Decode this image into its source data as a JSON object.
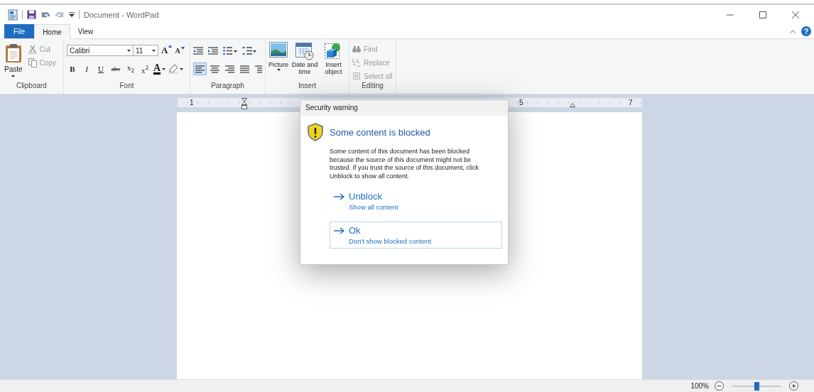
{
  "window": {
    "title": "Document - WordPad",
    "help": "?"
  },
  "tabs": [
    {
      "label": "File",
      "kind": "file",
      "selected": false
    },
    {
      "label": "Home",
      "kind": "tab",
      "selected": true
    },
    {
      "label": "View",
      "kind": "tab",
      "selected": false
    }
  ],
  "ribbon": {
    "clipboard": {
      "label": "Clipboard",
      "paste": "Paste",
      "cut": {
        "label": "Cut",
        "disabled": true
      },
      "copy": {
        "label": "Copy",
        "disabled": true
      }
    },
    "font": {
      "label": "Font",
      "font_name": "Calibri",
      "font_size": "11",
      "grow": "A",
      "shrink": "A",
      "format_buttons": [
        {
          "label": "B",
          "kind": "bold"
        },
        {
          "label": "I",
          "kind": "italic"
        },
        {
          "label": "U",
          "kind": "underline"
        },
        {
          "label": "abc",
          "kind": "strike"
        },
        {
          "label": "x$_{2}$",
          "kind": "plain"
        },
        {
          "label": "x$^{2}$",
          "kind": "plain"
        }
      ],
      "font_color": "A"
    },
    "paragraph": {
      "label": "Paragraph",
      "alignments": [
        {
          "kind": "left",
          "selected": true
        },
        {
          "kind": "center",
          "selected": false
        },
        {
          "kind": "right",
          "selected": false
        },
        {
          "kind": "justify",
          "selected": false
        },
        {
          "kind": "paragraph",
          "selected": false
        }
      ]
    },
    "insert": {
      "label": "Insert",
      "items": [
        {
          "label": "Picture",
          "kind": "picture",
          "dropdown": true
        },
        {
          "label": "Date and time",
          "kind": "datetime",
          "dropdown": false
        },
        {
          "label": "Insert object",
          "kind": "object",
          "dropdown": false
        }
      ]
    },
    "editing": {
      "label": "Editing",
      "items": [
        {
          "label": "Find",
          "kind": "find",
          "disabled": true
        },
        {
          "label": "Replace",
          "kind": "replace",
          "disabled": true
        },
        {
          "label": "Select all",
          "kind": "selectall",
          "disabled": true
        }
      ]
    }
  },
  "ruler": {
    "numbers": [
      "1",
      "5",
      "7"
    ]
  },
  "dialog": {
    "title": "Security warning",
    "heading": "Some content is blocked",
    "message": "Some content of this document has been blocked because the source of this document might not be trusted. If you trust the source of this document, click Unblock to show all content.",
    "options": [
      {
        "title": "Unblock",
        "subtitle": "Show all content",
        "selected": false
      },
      {
        "title": "Ok",
        "subtitle": "Don't show blocked content",
        "selected": true
      }
    ]
  },
  "status_bar": {
    "zoom": "100%",
    "zoom_slider": {
      "level": 0.5
    }
  }
}
